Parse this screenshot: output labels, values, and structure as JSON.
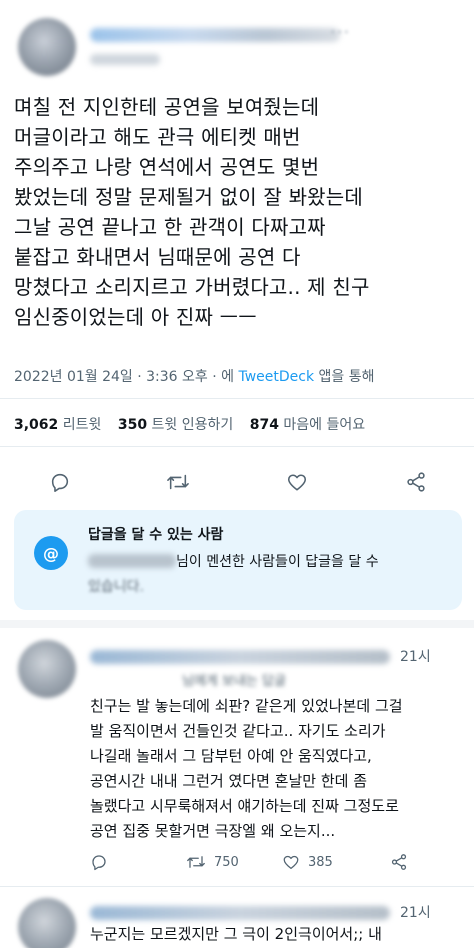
{
  "main_tweet": {
    "lines": [
      "며칠 전 지인한테 공연을 보여줬는데",
      "머글이라고 해도 관극 에티켓 매번",
      "주의주고 나랑 연석에서 공연도 몇번",
      "봤었는데 정말 문제될거 없이 잘 봐왔는데",
      "그날 공연 끝나고 한 관객이 다짜고짜",
      "붙잡고 화내면서 님때문에 공연 다",
      "망쳤다고 소리지르고 가버렸다고.. 제 친구",
      "임신중이었는데 아 진짜 ㅡㅡ"
    ],
    "timestamp_prefix": "2022년 01월 24일 · 3:36 오후 · 에 ",
    "client": "TweetDeck",
    "timestamp_suffix": " 앱을 통해",
    "retweets_count": "3,062",
    "retweets_label": "리트윗",
    "quotes_count": "350",
    "quotes_label": "트윗 인용하기",
    "likes_count": "874",
    "likes_label": "마음에 들어요"
  },
  "reply_restriction": {
    "title": "답글을 달 수 있는 사람",
    "line1": "님이 멘션한 사람들이 답글을 달 수",
    "line2": "있습니다."
  },
  "replies": [
    {
      "time": "21시",
      "to_label": "님에게 보내는 답글",
      "lines": [
        "친구는 발 놓는데에 쇠판? 같은게 있었나본데 그걸",
        "발 움직이면서 건들인것 같다고.. 자기도 소리가",
        "나길래 놀래서 그 담부턴 아예 안 움직였다고,",
        "공연시간 내내 그런거 였다면 혼날만 한데 좀",
        "놀랬다고 시무룩해져서 얘기하는데 진짜 그정도로",
        "공연 집중 못할거면 극장엘 왜 오는지..."
      ],
      "retweets": "750",
      "likes": "385"
    },
    {
      "time": "21시",
      "lines": [
        "누군지는 모르겠지만 그 극이 2인극이어서;; 내"
      ]
    }
  ],
  "icons": {
    "reply": "reply-icon",
    "retweet": "retweet-icon",
    "like": "heart-icon",
    "share": "share-icon",
    "mention": "at-icon"
  },
  "colors": {
    "accent": "#1d9bf0",
    "text": "#0f1419",
    "secondary": "#536471",
    "reply_box_bg": "#e8f5fd"
  }
}
